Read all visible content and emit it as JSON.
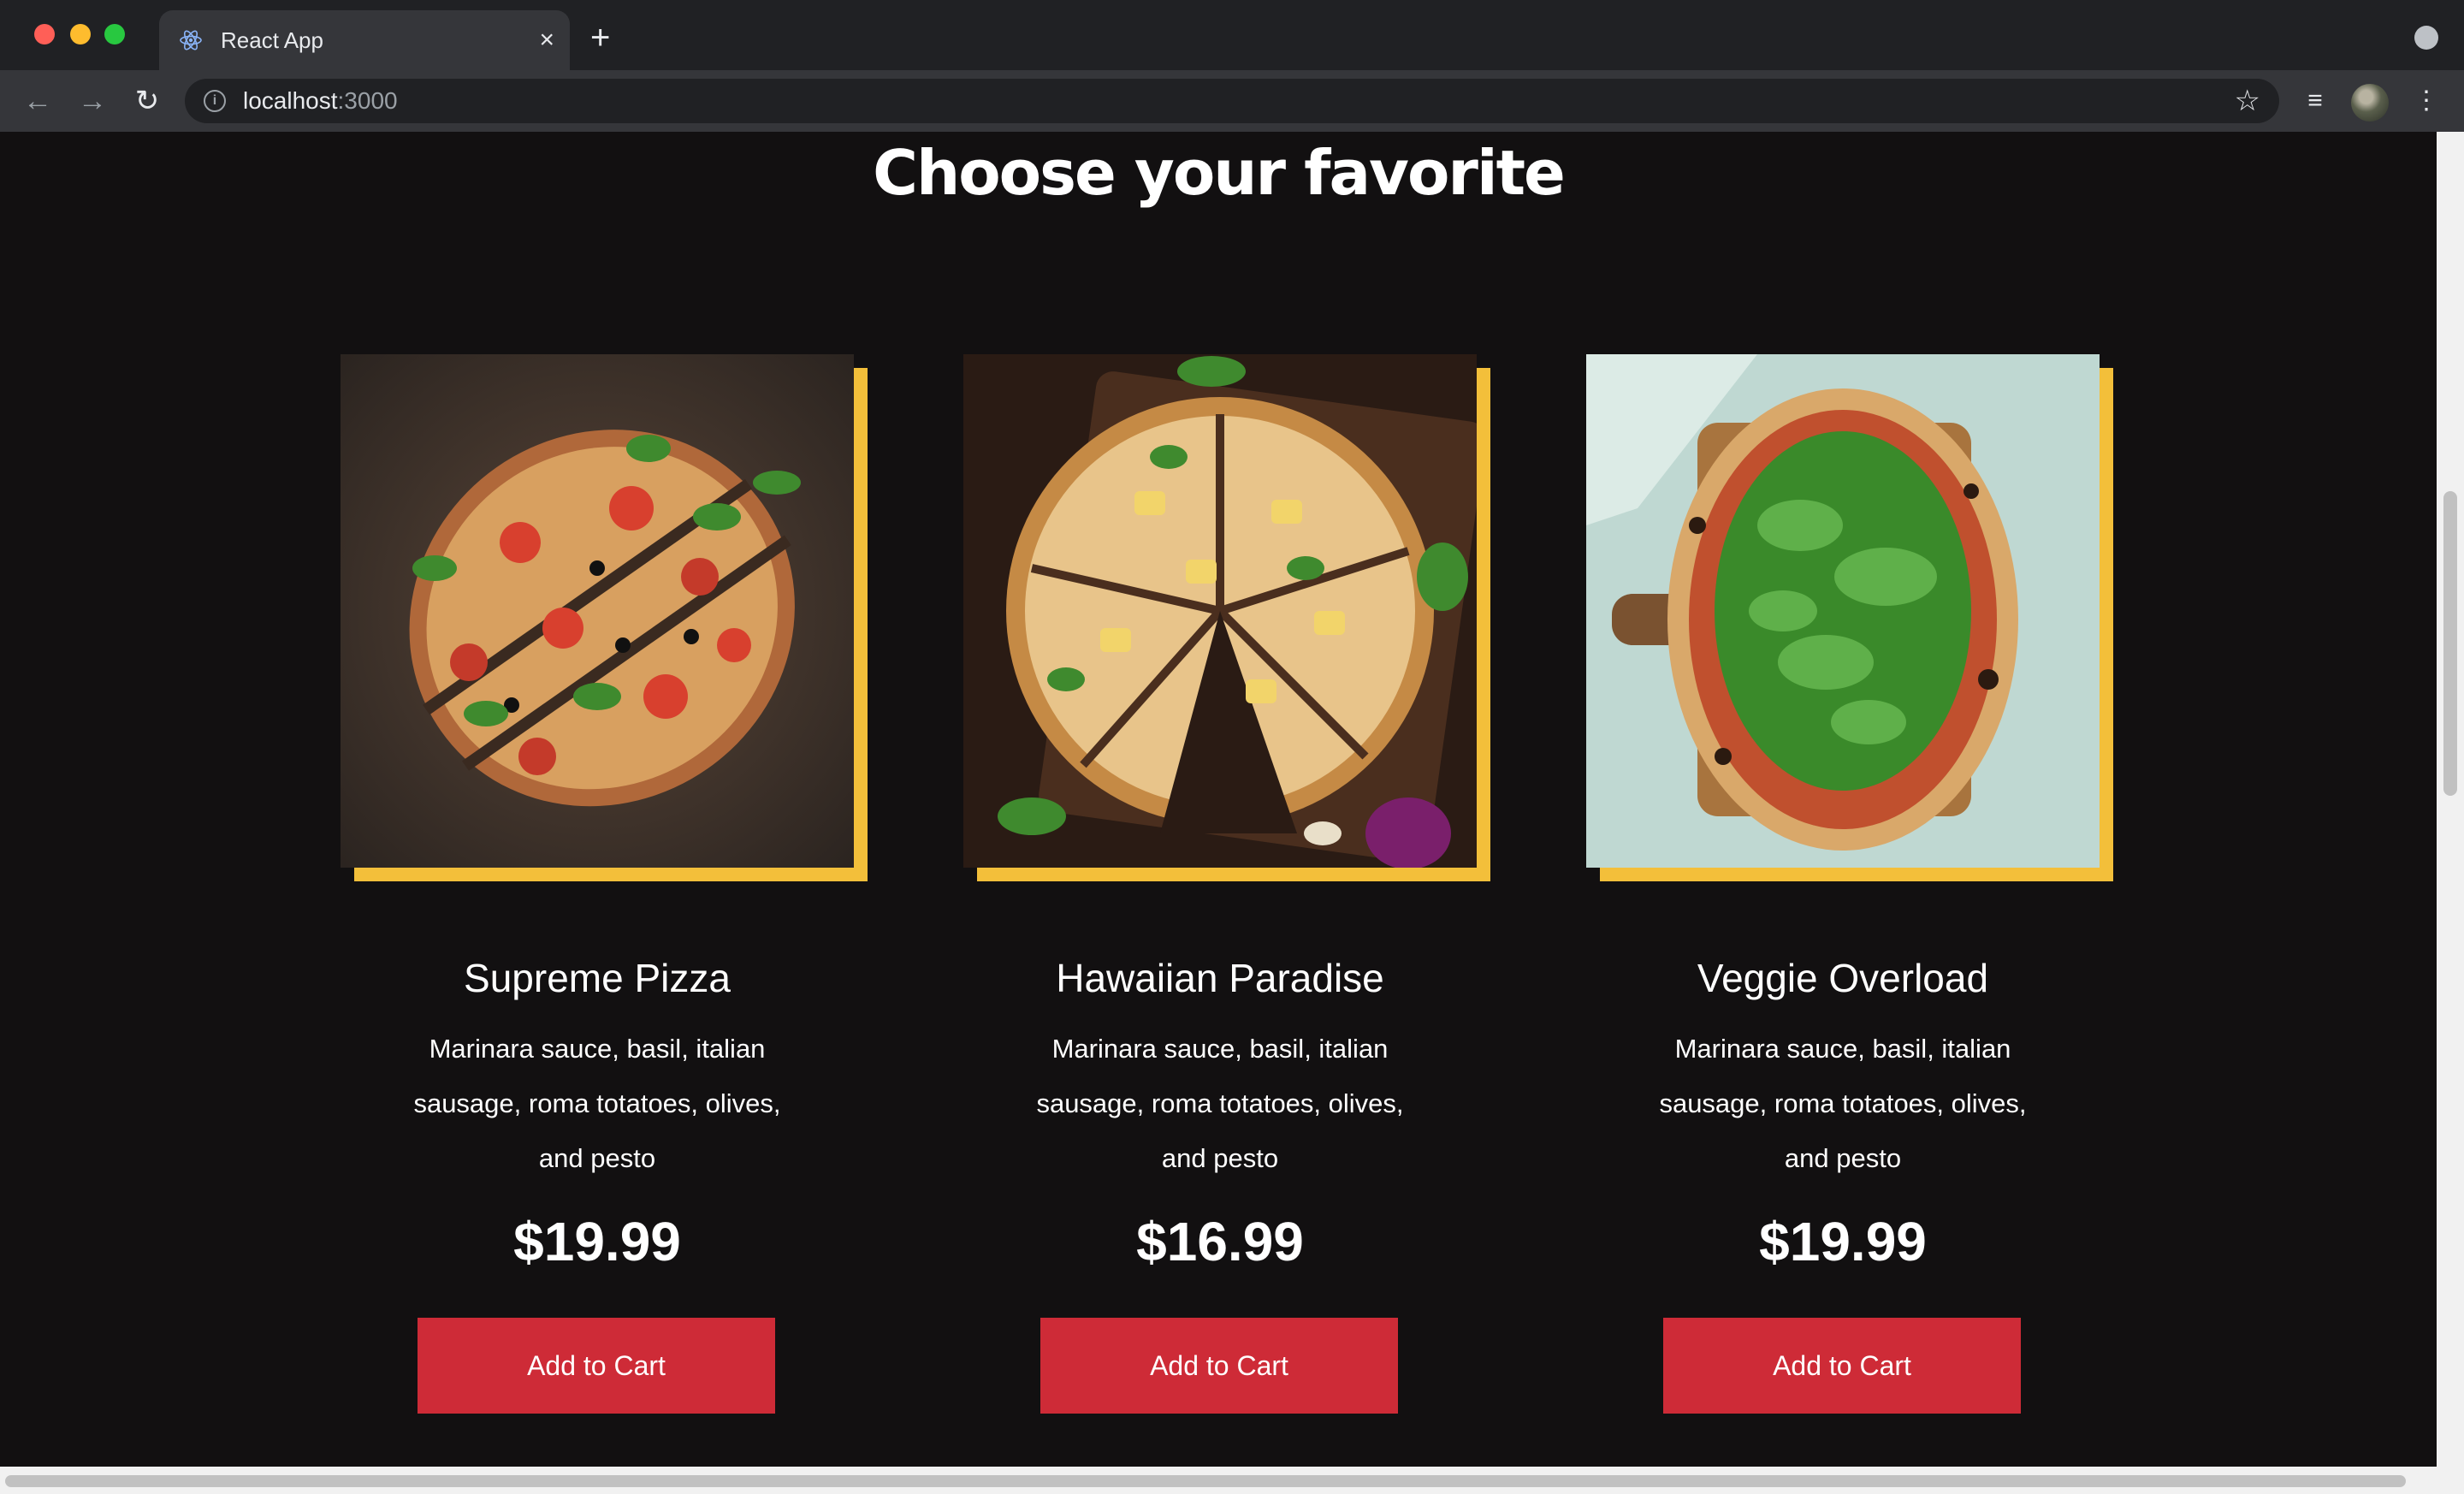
{
  "browser": {
    "tab_title": "React App",
    "tab_close": "×",
    "new_tab": "+",
    "url_host": "localhost",
    "url_port": ":3000"
  },
  "page": {
    "heading": "Choose your favorite",
    "products": [
      {
        "name": "Supreme Pizza",
        "description": "Marinara sauce, basil, italian sausage, roma totatoes, olives, and pesto",
        "price": "$19.99",
        "button": "Add to Cart"
      },
      {
        "name": "Hawaiian Paradise",
        "description": "Marinara sauce, basil, italian sausage, roma totatoes, olives, and pesto",
        "price": "$16.99",
        "button": "Add to Cart"
      },
      {
        "name": "Veggie Overload",
        "description": "Marinara sauce, basil, italian sausage, roma totatoes, olives, and pesto",
        "price": "$19.99",
        "button": "Add to Cart"
      }
    ]
  },
  "colors": {
    "background": "#121011",
    "accent_border": "#f3bf3a",
    "button": "#ce2b37"
  },
  "icons": [
    "react-logo-icon",
    "back-arrow-icon",
    "forward-arrow-icon",
    "reload-icon",
    "info-icon",
    "star-icon",
    "media-queue-icon",
    "menu-dots-icon",
    "tab-search-icon"
  ]
}
